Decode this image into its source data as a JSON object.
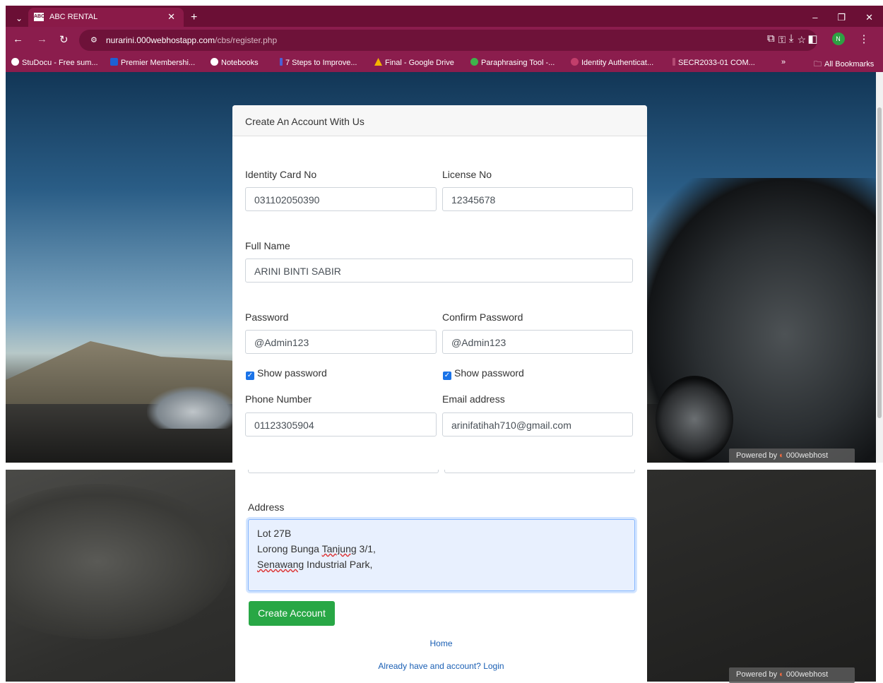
{
  "browser": {
    "tab_title": "ABC RENTAL",
    "tab_favicon": "ABC",
    "url_host": "nurarini.000webhostapp.com",
    "url_path": "/cbs/register.php",
    "profile_initial": "N",
    "bookmarks": [
      "StuDocu - Free sum...",
      "Premier Membershi...",
      "Notebooks",
      "7 Steps to Improve...",
      "Final - Google Drive",
      "Paraphrasing Tool -...",
      "Identity Authenticat...",
      "SECR2033-01 COM..."
    ],
    "bookmarks_overflow": "»",
    "all_bookmarks": "All Bookmarks"
  },
  "form": {
    "title": "Create An Account With Us",
    "identity_label": "Identity Card No",
    "identity_value": "031102050390",
    "license_label": "License No",
    "license_value": "12345678",
    "fullname_label": "Full Name",
    "fullname_value": "ARINI BINTI SABIR",
    "password_label": "Password",
    "password_value": "@Admin123",
    "confirm_label": "Confirm Password",
    "confirm_value": "@Admin123",
    "show_password": "Show password",
    "phone_label": "Phone Number",
    "phone_value": "01123305904",
    "email_label": "Email address",
    "email_value": "arinifatihah710@gmail.com",
    "address_label": "Address",
    "address_line1": "Lot 27B",
    "address_line2_pre": "Lorong Bunga ",
    "address_line2_sq": "Tanjung",
    "address_line2_post": " 3/1,",
    "address_line3_sq": "Senawang",
    "address_line3_post": " Industrial Park,",
    "submit_label": "Create Account",
    "home_link": "Home",
    "login_link": "Already have and account? Login"
  },
  "footer": {
    "powered_pre": "Powered by",
    "powered_brand": "000webhost"
  },
  "colors": {
    "browser_frame": "#8b1d4d",
    "submit_button": "#28a745",
    "link": "#1a5fb4"
  }
}
